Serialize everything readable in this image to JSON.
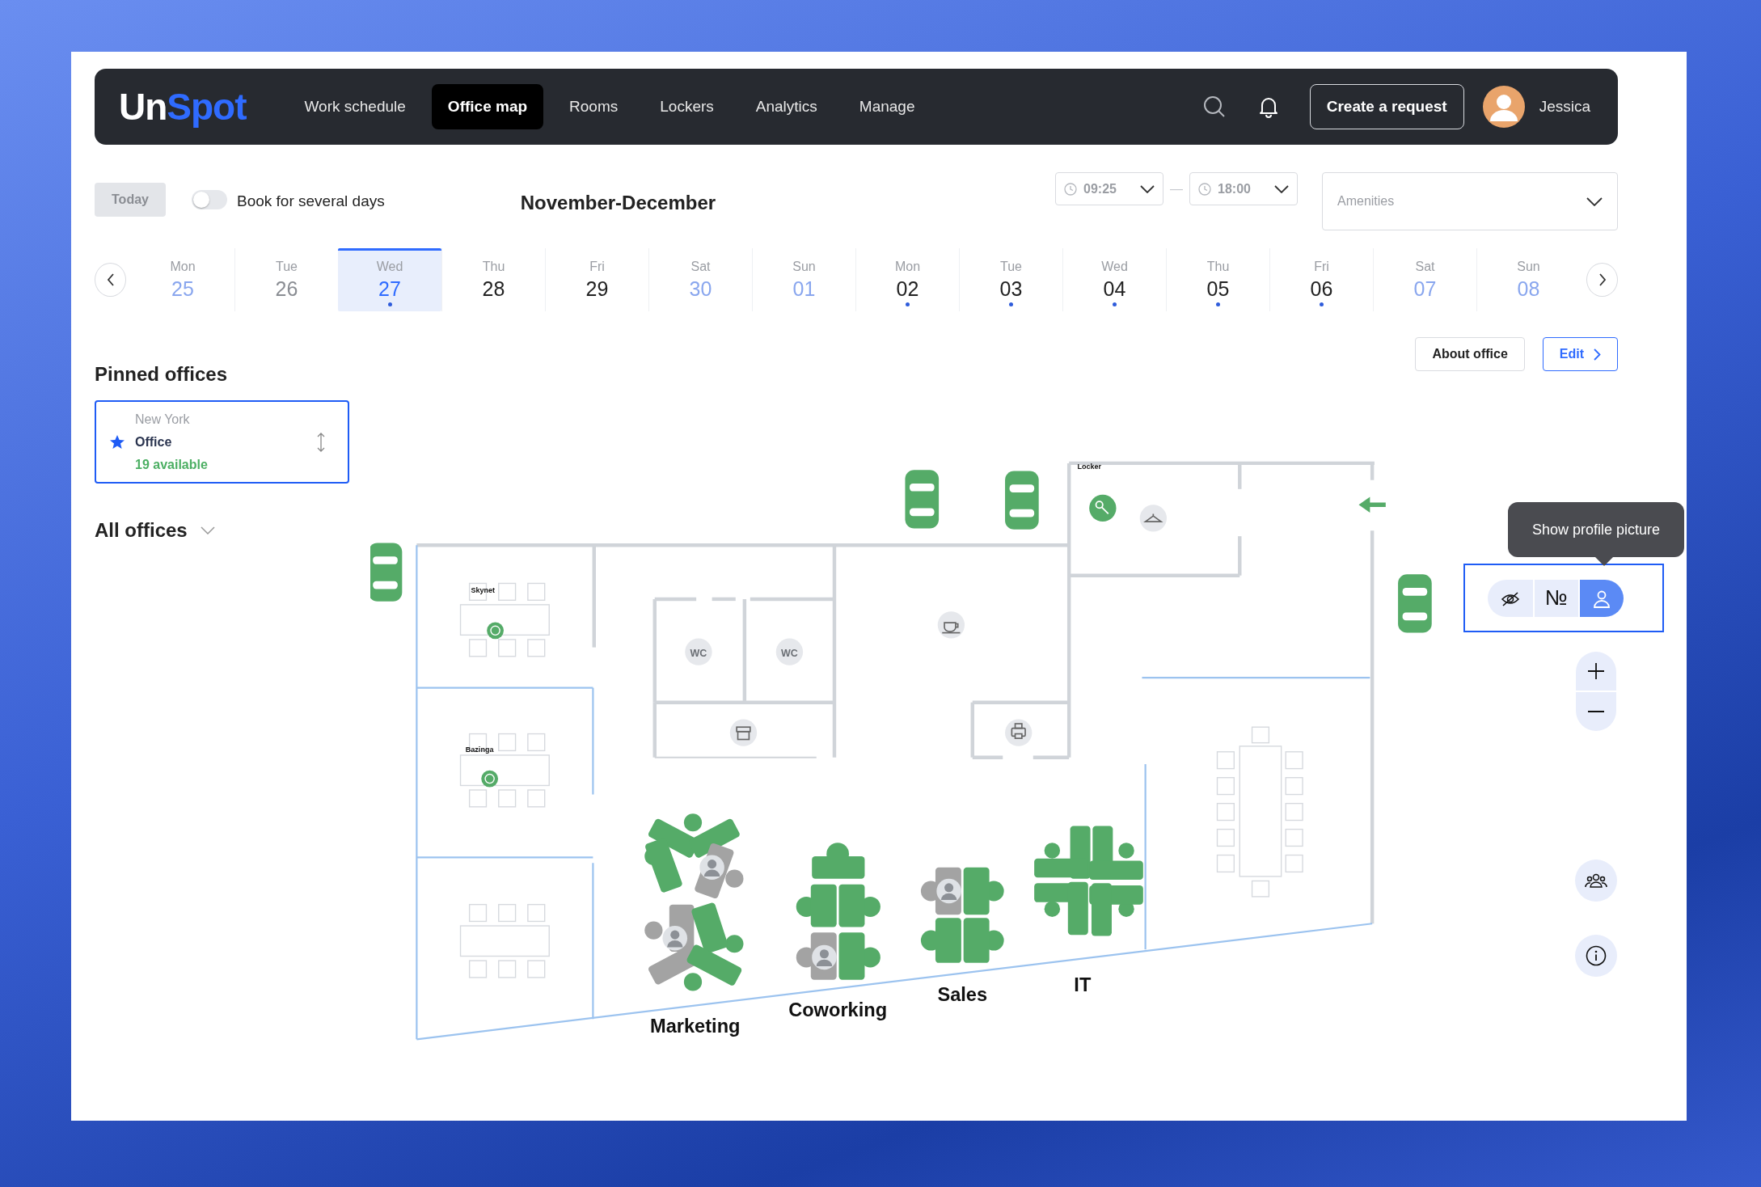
{
  "nav": {
    "logo": [
      {
        "text": "Un",
        "kind": "plain"
      },
      {
        "text": "Spot",
        "kind": "accent"
      }
    ],
    "tabs": [
      {
        "label": "Work schedule",
        "selected": false
      },
      {
        "label": "Office map",
        "selected": true
      },
      {
        "label": "Rooms",
        "selected": false
      },
      {
        "label": "Lockers",
        "selected": false
      },
      {
        "label": "Analytics",
        "selected": false
      },
      {
        "label": "Manage",
        "selected": false
      }
    ],
    "create_button": "Create a request",
    "user": "Jessica"
  },
  "toolbar": {
    "today": {
      "label": "Today",
      "disabled": true
    },
    "toggle": {
      "label": "Book for several days",
      "on": false
    },
    "period": "November-December",
    "time_from": "09:25",
    "separator": "—",
    "time_to": "18:00",
    "amenities": {
      "placeholder": "Amenities"
    }
  },
  "days": [
    {
      "weekday": "Mon",
      "date": "25",
      "color": "#89a6ee",
      "dot": false,
      "selected": false
    },
    {
      "weekday": "Tue",
      "date": "26",
      "color": "#8a8d93",
      "dot": false,
      "selected": false
    },
    {
      "weekday": "Wed",
      "date": "27",
      "color": "#2f6bff",
      "dot": true,
      "selected": true
    },
    {
      "weekday": "Thu",
      "date": "28",
      "color": "#222222",
      "dot": false,
      "selected": false
    },
    {
      "weekday": "Fri",
      "date": "29",
      "color": "#222222",
      "dot": false,
      "selected": false
    },
    {
      "weekday": "Sat",
      "date": "30",
      "color": "#89a6ee",
      "dot": false,
      "selected": false
    },
    {
      "weekday": "Sun",
      "date": "01",
      "color": "#89a6ee",
      "dot": false,
      "selected": false
    },
    {
      "weekday": "Mon",
      "date": "02",
      "color": "#222222",
      "dot": true,
      "selected": false
    },
    {
      "weekday": "Tue",
      "date": "03",
      "color": "#222222",
      "dot": true,
      "selected": false
    },
    {
      "weekday": "Wed",
      "date": "04",
      "color": "#222222",
      "dot": true,
      "selected": false
    },
    {
      "weekday": "Thu",
      "date": "05",
      "color": "#222222",
      "dot": true,
      "selected": false
    },
    {
      "weekday": "Fri",
      "date": "06",
      "color": "#222222",
      "dot": true,
      "selected": false
    },
    {
      "weekday": "Sat",
      "date": "07",
      "color": "#89a6ee",
      "dot": false,
      "selected": false
    },
    {
      "weekday": "Sun",
      "date": "08",
      "color": "#89a6ee",
      "dot": false,
      "selected": false
    }
  ],
  "actions": [
    {
      "label": "About office",
      "kind": "plain"
    },
    {
      "label": "Edit",
      "kind": "primary"
    }
  ],
  "pinned": {
    "title": "Pinned offices",
    "offices": [
      {
        "city": "New York",
        "name": "Office",
        "available": "19 available",
        "starred": true
      }
    ]
  },
  "all_offices": {
    "title": "All offices",
    "expanded": false
  },
  "map": {
    "room_labels": [
      "Skynet",
      "Bazinga",
      "Locker"
    ],
    "wc_labels": [
      "WC",
      "WC"
    ],
    "zones": [
      "Marketing",
      "Coworking",
      "Sales",
      "IT"
    ]
  },
  "display_mode": {
    "tooltip": "Show profile picture",
    "options": [
      {
        "kind": "hidden",
        "selected": false
      },
      {
        "kind": "number",
        "label": "№",
        "selected": false
      },
      {
        "kind": "picture",
        "selected": true
      }
    ]
  }
}
